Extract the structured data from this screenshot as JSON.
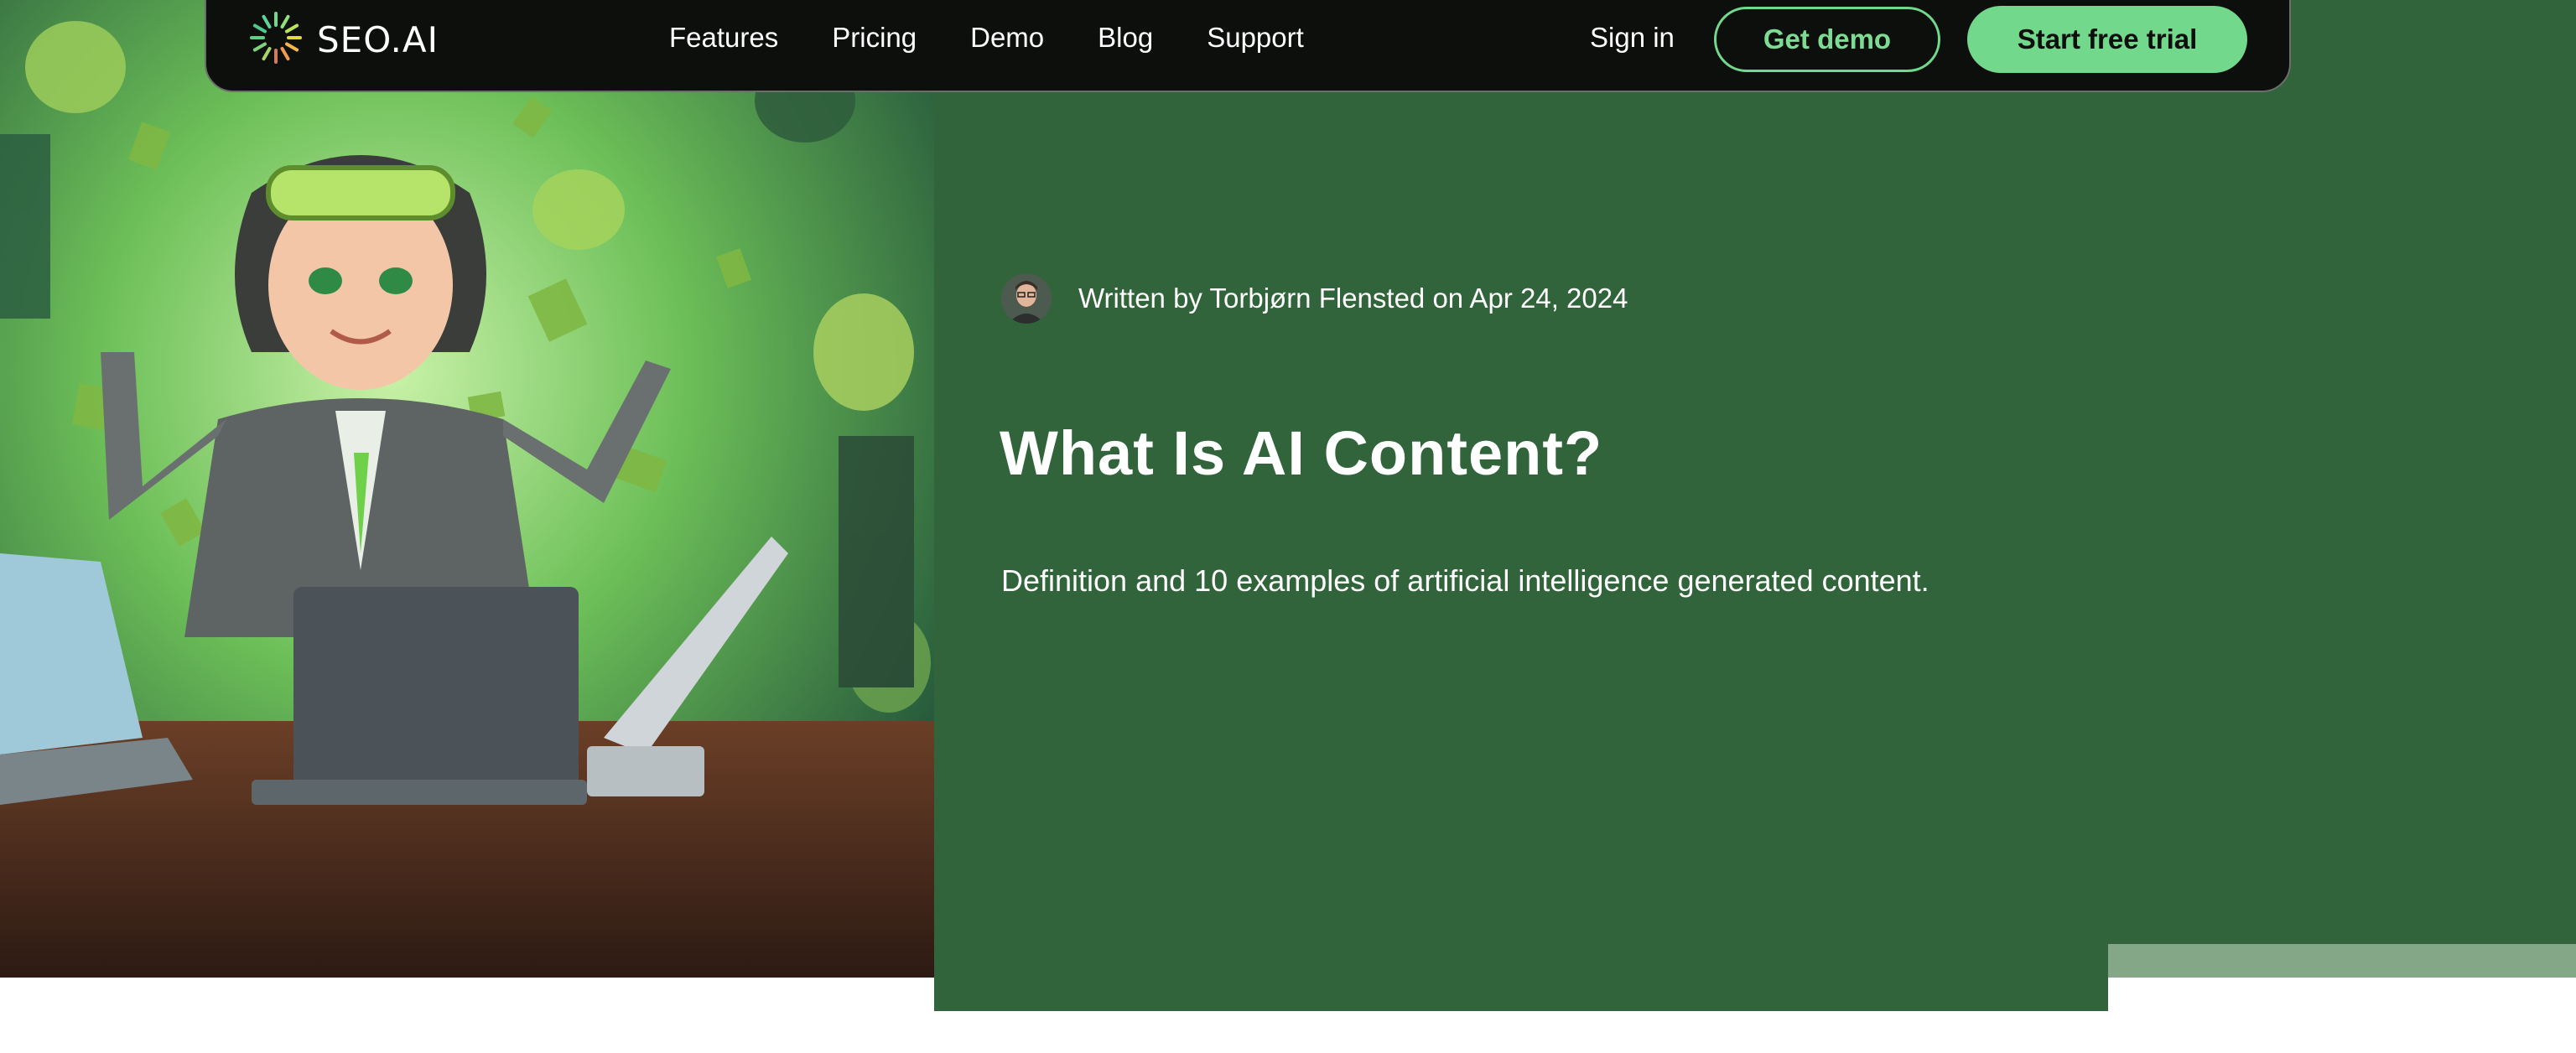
{
  "brand": {
    "name": "SEO.AI",
    "accent_color": "#72d98c",
    "nav_background": "#0d0f0d"
  },
  "nav": {
    "links": [
      "Features",
      "Pricing",
      "Demo",
      "Blog",
      "Support"
    ],
    "sign_in": "Sign in",
    "get_demo": "Get demo",
    "start_trial": "Start free trial"
  },
  "hero": {
    "background_color": "#31643a",
    "byline": "Written by Torbjørn Flensted on Apr 24, 2024",
    "title": "What Is AI Content?",
    "subtitle": "Definition and 10 examples of artificial intelligence generated content."
  },
  "icons": {
    "logo": "starburst-logo-icon",
    "avatar": "author-avatar"
  }
}
